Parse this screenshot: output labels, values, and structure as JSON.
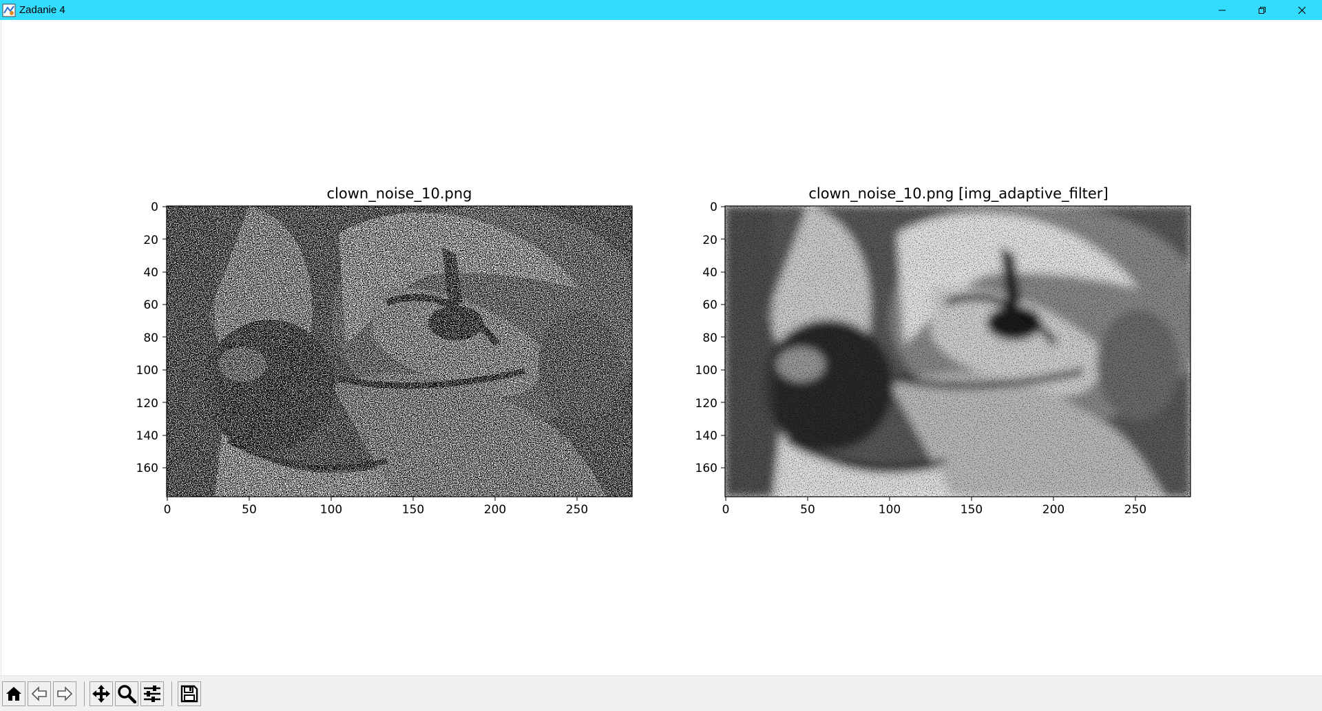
{
  "window": {
    "title": "Zadanie 4",
    "controls": [
      "minimize-icon",
      "restore-icon",
      "close-icon"
    ]
  },
  "axes": [
    {
      "title": "clown_noise_10.png",
      "xticks": [
        "0",
        "50",
        "100",
        "150",
        "200",
        "250"
      ],
      "yticks": [
        "0",
        "20",
        "40",
        "60",
        "80",
        "100",
        "120",
        "140",
        "160"
      ],
      "image": "noisy-clown-grayscale"
    },
    {
      "title": "clown_noise_10.png [img_adaptive_filter]",
      "xticks": [
        "0",
        "50",
        "100",
        "150",
        "200",
        "250"
      ],
      "yticks": [
        "0",
        "20",
        "40",
        "60",
        "80",
        "100",
        "120",
        "140",
        "160"
      ],
      "image": "filtered-clown-grayscale"
    }
  ],
  "toolbar": {
    "buttons": [
      "home-icon",
      "back-icon",
      "forward-icon",
      "pan-icon",
      "zoom-icon",
      "configure-subplots-icon",
      "save-icon"
    ],
    "message": ""
  }
}
